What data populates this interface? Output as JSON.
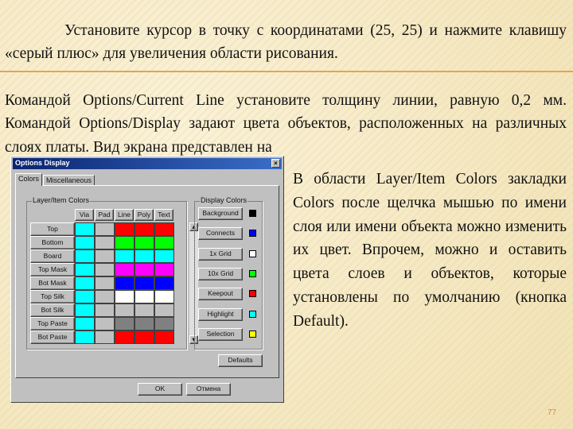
{
  "paragraph1": "Установите курсор в точку с координатами (25, 25) и нажмите клавишу «серый плюс» для увеличения области рисования.",
  "paragraph2": "Командой Options/Current Line установите толщину линии, равную 0,2 мм. Командой Options/Display задают цвета объектов, расположенных на различных слоях платы. Вид экрана представлен на",
  "right_text": "В области Layer/Item Colors закладки Colors после щелчка мышью по имени слоя или имени объекта можно изменить их цвет. Впрочем, можно и оставить цвета слоев и объектов, которые установлены по умолчанию (кнопка Default).",
  "page_number": "77",
  "dialog": {
    "title": "Options Display",
    "close": "×",
    "tabs": [
      "Colors",
      "Miscellaneous"
    ],
    "layer_group": "Layer/Item Colors",
    "columns": [
      "Via",
      "Pad",
      "Line",
      "Poly",
      "Text"
    ],
    "rows": [
      {
        "label": "Top",
        "colors": [
          "#00ffff",
          "#c0c0c0",
          "#ff0000",
          "#ff0000",
          "#ff0000"
        ]
      },
      {
        "label": "Bottom",
        "colors": [
          "#00ffff",
          "#c0c0c0",
          "#00ff00",
          "#00ff00",
          "#00ff00"
        ]
      },
      {
        "label": "Board",
        "colors": [
          "#00ffff",
          "#c0c0c0",
          "#00ffff",
          "#00ffff",
          "#00ffff"
        ]
      },
      {
        "label": "Top Mask",
        "colors": [
          "#00ffff",
          "#c0c0c0",
          "#ff00ff",
          "#ff00ff",
          "#ff00ff"
        ]
      },
      {
        "label": "Bot Mask",
        "colors": [
          "#00ffff",
          "#c0c0c0",
          "#0000ff",
          "#0000ff",
          "#0000ff"
        ]
      },
      {
        "label": "Top Silk",
        "colors": [
          "#00ffff",
          "#c0c0c0",
          "#ffffff",
          "#ffffff",
          "#ffffff"
        ]
      },
      {
        "label": "Bot Silk",
        "colors": [
          "#00ffff",
          "#c0c0c0",
          "#c0c0c0",
          "#c0c0c0",
          "#c0c0c0"
        ]
      },
      {
        "label": "Top Paste",
        "colors": [
          "#00ffff",
          "#c0c0c0",
          "#808080",
          "#808080",
          "#808080"
        ]
      },
      {
        "label": "Bot Paste",
        "colors": [
          "#00ffff",
          "#c0c0c0",
          "#ff0000",
          "#ff0000",
          "#ff0000"
        ]
      }
    ],
    "display_group": "Display Colors",
    "display_items": [
      {
        "label": "Background",
        "color": "#000000"
      },
      {
        "label": "Connects",
        "color": "#0000ff"
      },
      {
        "label": "1x Grid",
        "color": "#ffffff"
      },
      {
        "label": "10x Grid",
        "color": "#00ff00"
      },
      {
        "label": "Keepout",
        "color": "#ff0000"
      },
      {
        "label": "Highlight",
        "color": "#00ffff"
      },
      {
        "label": "Selection",
        "color": "#ffff00"
      }
    ],
    "defaults": "Defaults",
    "ok": "OK",
    "cancel": "Отмена"
  }
}
